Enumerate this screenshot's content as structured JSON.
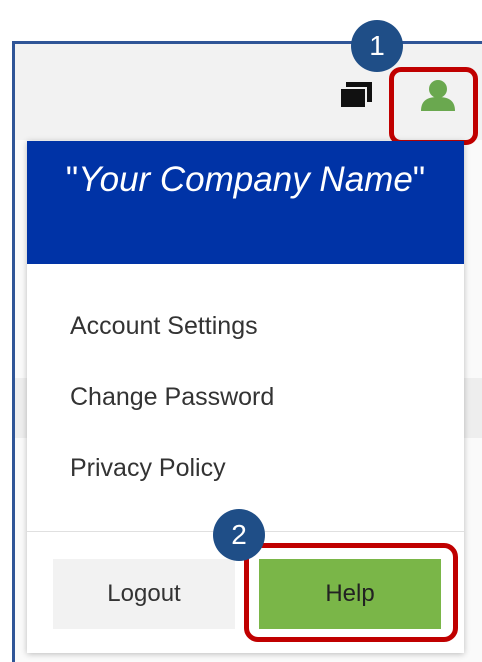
{
  "header": {
    "company_name_prefix": "\"",
    "company_name_italic": "Your Company Name",
    "company_name_suffix": "\""
  },
  "toolbar": {
    "windows_icon": "windows-icon",
    "user_icon": "user-icon"
  },
  "menu": {
    "items": [
      {
        "label": "Account Settings"
      },
      {
        "label": "Change Password"
      },
      {
        "label": "Privacy Policy"
      }
    ]
  },
  "actions": {
    "logout_label": "Logout",
    "help_label": "Help"
  },
  "annotations": {
    "step_1": "1",
    "step_2": "2"
  },
  "colors": {
    "header_bg": "#0033a6",
    "help_bg": "#7ab648",
    "highlight": "#c00000",
    "badge": "#1f4e87",
    "user_icon": "#6aa84f"
  }
}
